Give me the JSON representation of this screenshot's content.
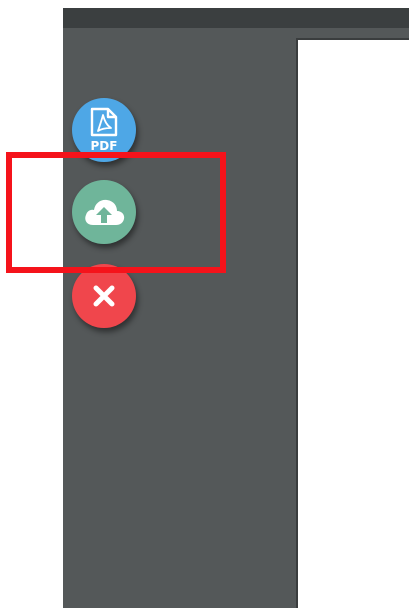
{
  "toolbar": {
    "pdf_button": {
      "icon": "pdf-file-icon",
      "icon_text": "PDF",
      "color": "#4ea7e6"
    },
    "upload_button": {
      "icon": "cloud-upload-icon",
      "color": "#6fb59a"
    },
    "close_button": {
      "icon": "close-icon",
      "color": "#f0464c"
    }
  },
  "colors": {
    "sidebar_bg": "#545859",
    "top_bar_bg": "#3b3f40",
    "page_bg": "#ffffff",
    "highlight_border": "#f5131b"
  }
}
